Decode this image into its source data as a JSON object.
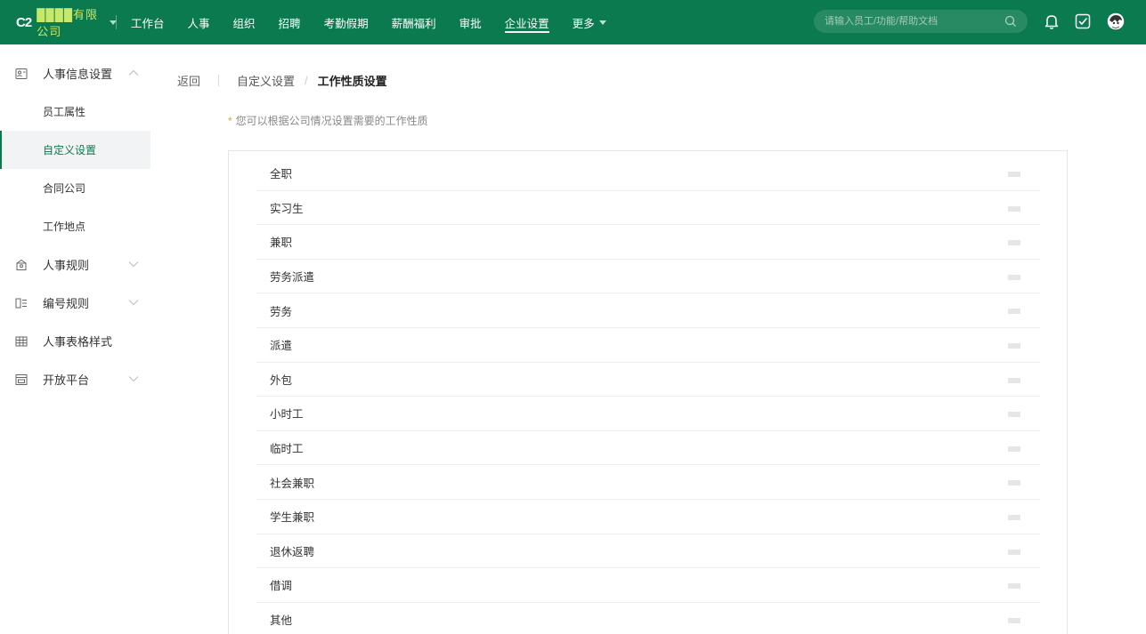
{
  "colors": {
    "brand": "#0b7a4e",
    "accent": "#0b7a4e",
    "hint_star": "#f0a020"
  },
  "topbar": {
    "logo": "C2",
    "company_name": "████有限公司",
    "nav": [
      "工作台",
      "人事",
      "组织",
      "招聘",
      "考勤假期",
      "薪酬福利",
      "审批",
      "企业设置",
      "更多"
    ],
    "active_nav": "企业设置",
    "search_placeholder": "请输入员工/功能/帮助文档",
    "icons": [
      "search-icon",
      "bell-icon",
      "todo-check-icon",
      "user-avatar"
    ]
  },
  "sidebar": {
    "groups": [
      {
        "label": "人事信息设置",
        "icon": "profile-card-icon",
        "expanded": true,
        "items": [
          "员工属性",
          "自定义设置",
          "合同公司",
          "工作地点"
        ],
        "active_item": "自定义设置"
      },
      {
        "label": "人事规则",
        "icon": "rules-icon",
        "expanded": false
      },
      {
        "label": "编号规则",
        "icon": "numbering-icon",
        "expanded": false
      },
      {
        "label": "人事表格样式",
        "icon": "table-grid-icon"
      },
      {
        "label": "开放平台",
        "icon": "open-platform-icon",
        "expanded": false
      }
    ]
  },
  "main": {
    "back_label": "返回",
    "breadcrumb": {
      "parent": "自定义设置",
      "current": "工作性质设置"
    },
    "hint": "您可以根据公司情况设置需要的工作性质",
    "work_types": [
      "全职",
      "实习生",
      "兼职",
      "劳务派遣",
      "劳务",
      "派遣",
      "外包",
      "小时工",
      "临时工",
      "社会兼职",
      "学生兼职",
      "退休返聘",
      "借调",
      "其他"
    ]
  }
}
